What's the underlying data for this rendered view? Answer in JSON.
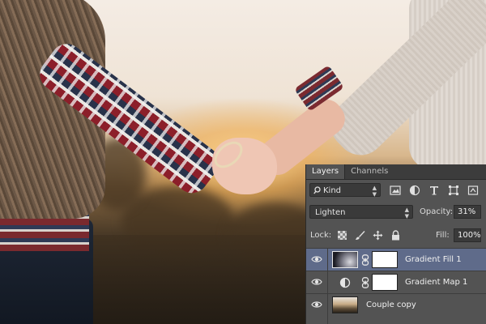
{
  "layers_panel": {
    "tabs": [
      {
        "label": "Layers",
        "active": true
      },
      {
        "label": "Channels",
        "active": false
      }
    ],
    "filter": {
      "label": "Kind"
    },
    "blend_mode": "Lighten",
    "opacity": {
      "label": "Opacity:",
      "value": "31%"
    },
    "lock": {
      "label": "Lock:"
    },
    "fill": {
      "label": "Fill:",
      "value": "100%"
    },
    "layers": [
      {
        "name": "Gradient Fill 1",
        "visible": true,
        "selected": true,
        "thumb": "gradient-fill",
        "mask": true
      },
      {
        "name": "Gradient Map 1",
        "visible": true,
        "selected": false,
        "thumb": "adjustment",
        "mask": true
      },
      {
        "name": "Couple copy",
        "visible": true,
        "selected": false,
        "thumb": "photo",
        "mask": false
      }
    ],
    "colors": {
      "panel": "#535353",
      "tabbar": "#3c3c3c",
      "selected_row": "#5f6b8a"
    }
  }
}
